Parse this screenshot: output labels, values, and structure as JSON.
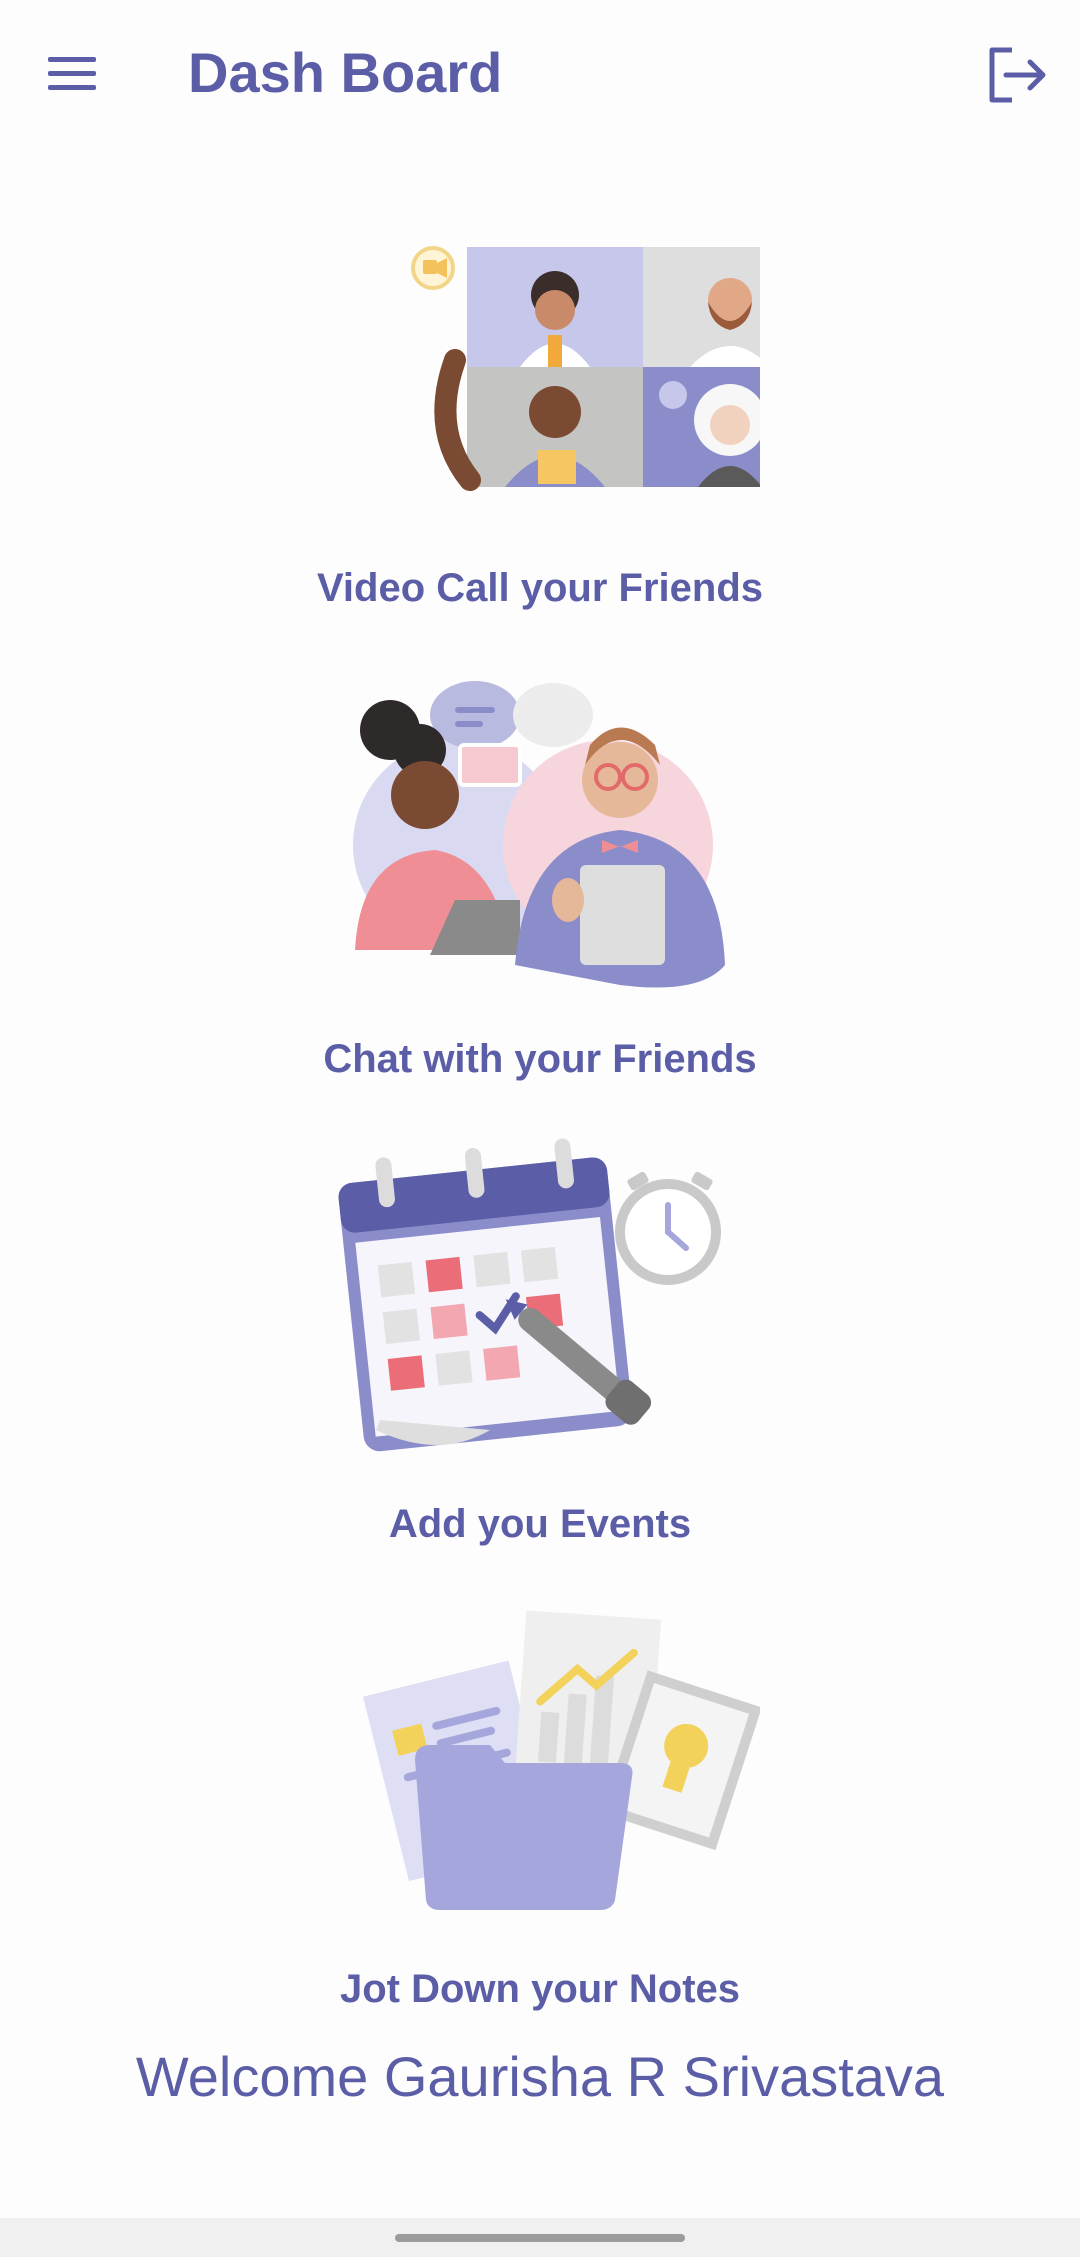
{
  "header": {
    "title": "Dash Board",
    "menu_icon": "hamburger-menu-icon",
    "logout_icon": "logout-icon"
  },
  "cards": [
    {
      "label": "Video Call your Friends",
      "illustration": "video-call-illustration"
    },
    {
      "label": "Chat with your Friends",
      "illustration": "chat-illustration"
    },
    {
      "label": "Add you Events",
      "illustration": "calendar-events-illustration"
    },
    {
      "label": "Jot Down your Notes",
      "illustration": "notes-folder-illustration"
    }
  ],
  "welcome": "Welcome Gaurisha R Srivastava",
  "colors": {
    "primary": "#5b5ea6",
    "lavender": "#a5a6dc",
    "background": "#fdfdfe"
  }
}
